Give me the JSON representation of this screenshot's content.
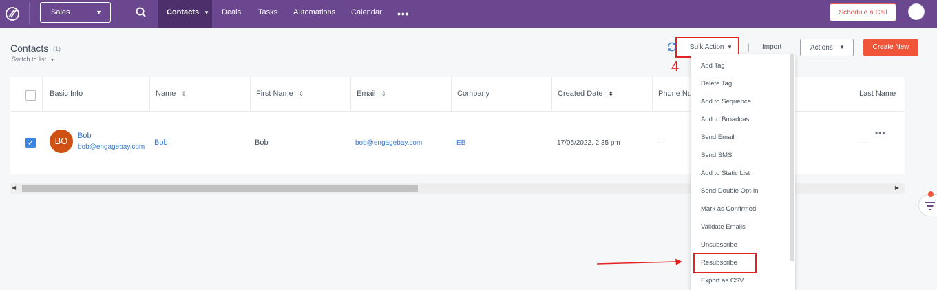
{
  "nav": {
    "module_select": "Sales",
    "items": [
      "Contacts",
      "Deals",
      "Tasks",
      "Automations",
      "Calendar"
    ],
    "more": "•••",
    "schedule_call": "Schedule a Call"
  },
  "header": {
    "title": "Contacts",
    "count": "(1)",
    "switch_view": "Switch to list",
    "bulk_action": "Bulk Action",
    "import": "Import",
    "actions": "Actions",
    "create_new": "Create New"
  },
  "annotation": {
    "step": "4"
  },
  "table": {
    "columns": [
      "Basic Info",
      "Name",
      "First Name",
      "Email",
      "Company",
      "Created Date",
      "Phone Nu",
      "Last Name"
    ],
    "row": {
      "avatar_initials": "BO",
      "display_name": "Bob",
      "basic_email": "bob@engagebay.com",
      "name": "Bob",
      "first_name": "Bob",
      "email": "bob@engagebay.com",
      "company": "EB",
      "created_date": "17/05/2022, 2:35 pm",
      "phone": "—",
      "last_name": "—",
      "more": "•••"
    }
  },
  "bulk_menu": [
    "Add Tag",
    "Delete Tag",
    "Add to Sequence",
    "Add to Broadcast",
    "Send Email",
    "Send SMS",
    "Add to Static List",
    "Send Double Opt-in",
    "Mark as Confirmed",
    "Validate Emails",
    "Unsubscribe",
    "Resubscribe",
    "Export as CSV"
  ],
  "colors": {
    "nav_bg": "#6b4790",
    "nav_active": "#4c2f6b",
    "primary_button": "#f0553a",
    "link": "#3a7bd5",
    "highlight": "#e02424",
    "avatar": "#cf5013"
  }
}
